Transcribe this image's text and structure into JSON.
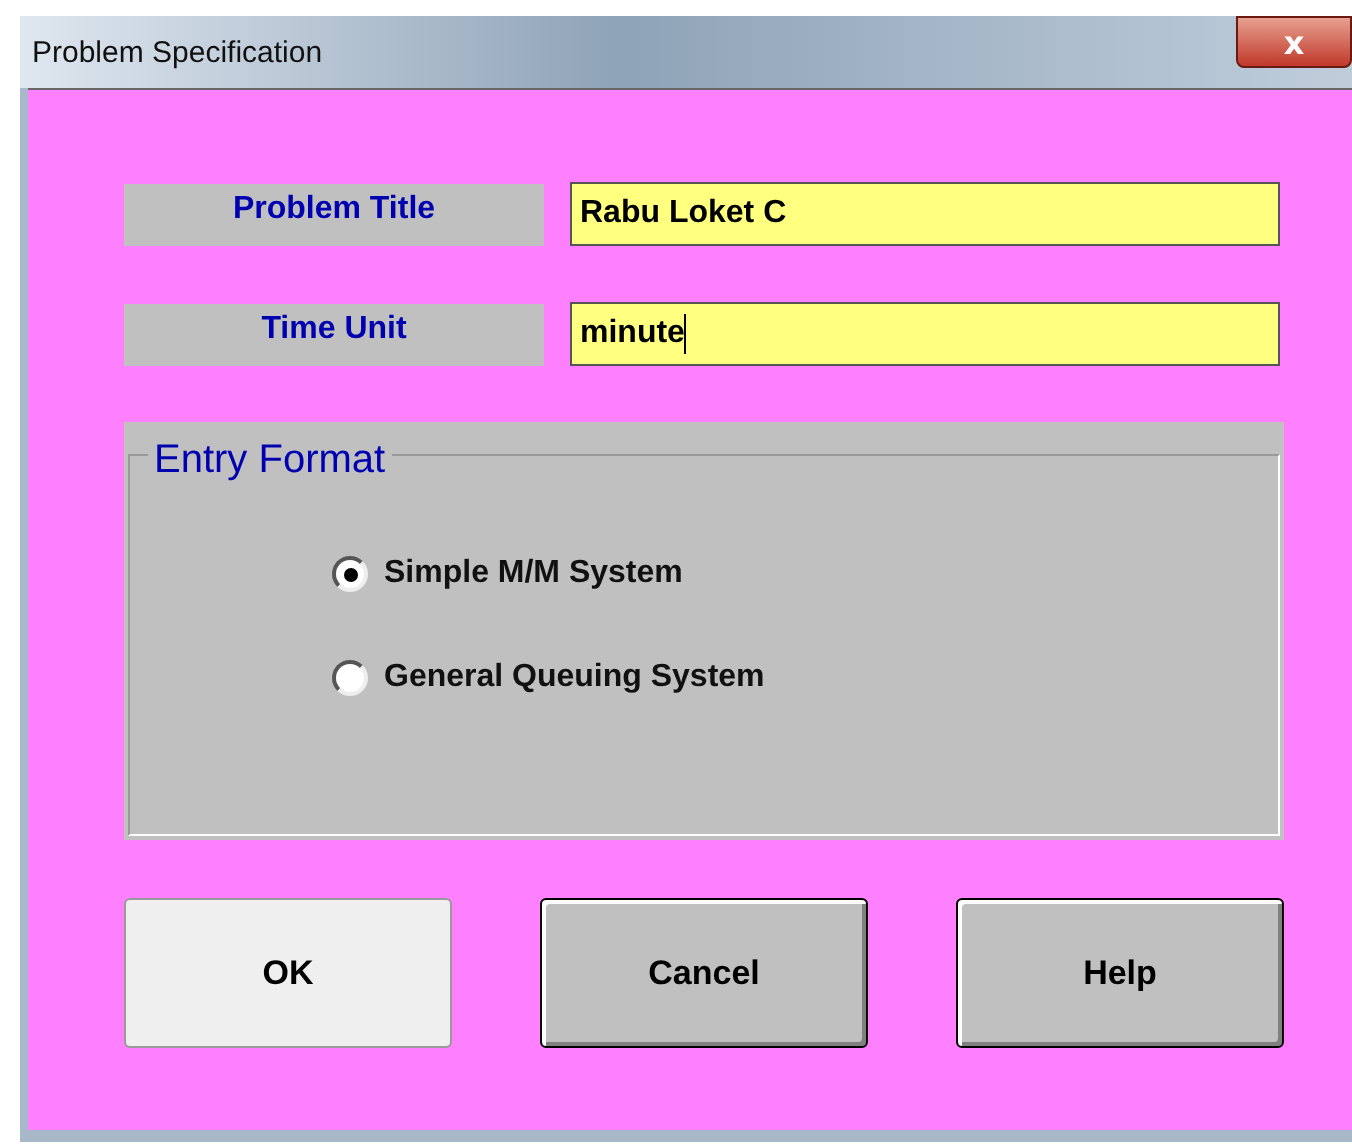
{
  "window": {
    "title": "Problem Specification",
    "close": "x"
  },
  "fields": [
    {
      "label": "Problem Title",
      "value": "Rabu Loket C",
      "focused": false
    },
    {
      "label": "Time Unit",
      "value": "minute",
      "focused": true
    }
  ],
  "entry_format": {
    "title": "Entry Format",
    "options": [
      {
        "label": "Simple M/M System",
        "selected": true
      },
      {
        "label": "General Queuing System",
        "selected": false
      }
    ]
  },
  "buttons": [
    {
      "label": "OK",
      "default": true
    },
    {
      "label": "Cancel",
      "default": false
    },
    {
      "label": "Help",
      "default": false
    }
  ]
}
